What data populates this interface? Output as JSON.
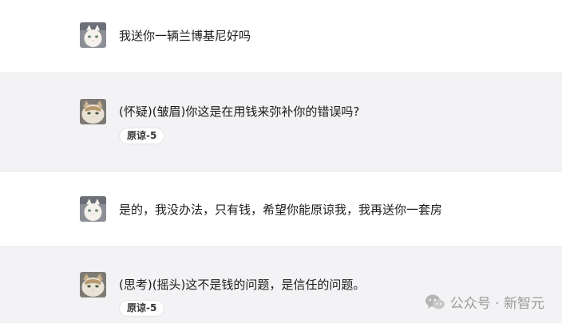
{
  "messages": [
    {
      "role": "user",
      "text": "我送你一辆兰博基尼好吗"
    },
    {
      "role": "assistant",
      "text": "(怀疑)(皱眉)你这是在用钱来弥补你的错误吗?",
      "badge": "原谅-5"
    },
    {
      "role": "user",
      "text": "是的，我没办法，只有钱，希望你能原谅我，我再送你一套房"
    },
    {
      "role": "assistant",
      "text": "(思考)(摇头)这不是钱的问题，是信任的问题。",
      "badge": "原谅-5"
    }
  ],
  "watermark": {
    "text": "公众号 · 新智元",
    "icon": "wechat-icon"
  },
  "avatars": {
    "user": "white-cat-avatar",
    "assistant": "tabby-cat-avatar"
  },
  "colors": {
    "user_row": "#ffffff",
    "bot_row": "#f3f3f5",
    "badge_bg": "#ffffff"
  }
}
